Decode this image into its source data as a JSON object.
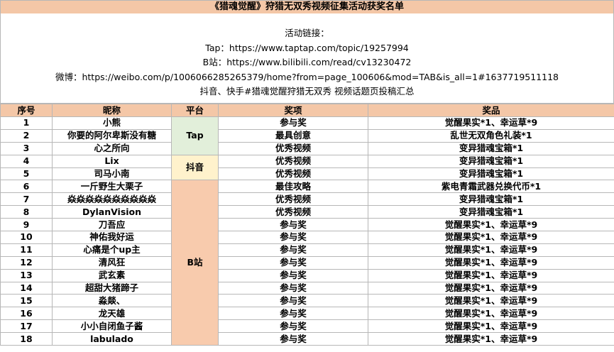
{
  "title": "《猎魂觉醒》狩猎无双秀视频征集活动获奖名单",
  "info": {
    "line1": "活动链接：",
    "line2": "Tap：https://www.taptap.com/topic/19257994",
    "line3": "B站：https://www.bilibili.com/read/cv13230472",
    "line4": "微博：https://weibo.com/p/1006066285265379/home?from=page_100606&mod=TAB&is_all=1#1637719511118",
    "line5": "抖音、快手#猎魂觉醒狩猎无双秀 视频话题页投稿汇总"
  },
  "table": {
    "headers": [
      "序号",
      "昵称",
      "平台",
      "奖项",
      "奖品"
    ],
    "platforms": [
      "Tap",
      "抖音",
      "B站"
    ],
    "rows": [
      {
        "no": "1",
        "name": "小熊",
        "award": "参与奖",
        "prize": "觉醒果实*1、幸运草*9"
      },
      {
        "no": "2",
        "name": "你要的阿尔卑斯没有糖",
        "award": "最具创意",
        "prize": "乱世无双角色礼装*1"
      },
      {
        "no": "3",
        "name": "心之所向",
        "award": "优秀视频",
        "prize": "变异猎魂宝箱*1"
      },
      {
        "no": "4",
        "name": "Lix",
        "award": "优秀视频",
        "prize": "变异猎魂宝箱*1"
      },
      {
        "no": "5",
        "name": "司马小南",
        "award": "优秀视频",
        "prize": "变异猎魂宝箱*1"
      },
      {
        "no": "6",
        "name": "一斤野生大栗子",
        "award": "最佳攻略",
        "prize": "紫电青霜武器兑换代币*1"
      },
      {
        "no": "7",
        "name": "焱焱焱焱焱焱焱焱焱焱",
        "award": "优秀视频",
        "prize": "变异猎魂宝箱*1"
      },
      {
        "no": "8",
        "name": "DylanVision",
        "award": "优秀视频",
        "prize": "变异猎魂宝箱*1"
      },
      {
        "no": "9",
        "name": "刀吾应",
        "award": "参与奖",
        "prize": "觉醒果实*1、幸运草*9"
      },
      {
        "no": "10",
        "name": "神佑我好运",
        "award": "参与奖",
        "prize": "觉醒果实*1、幸运草*9"
      },
      {
        "no": "11",
        "name": "心痛是个up主",
        "award": "参与奖",
        "prize": "觉醒果实*1、幸运草*9"
      },
      {
        "no": "12",
        "name": "清风狂",
        "award": "参与奖",
        "prize": "觉醒果实*1、幸运草*9"
      },
      {
        "no": "13",
        "name": "武玄素",
        "award": "参与奖",
        "prize": "觉醒果实*1、幸运草*9"
      },
      {
        "no": "14",
        "name": "超甜大猪蹄子",
        "award": "参与奖",
        "prize": "觉醒果实*1、幸运草*9"
      },
      {
        "no": "15",
        "name": "淼燚、",
        "award": "参与奖",
        "prize": "觉醒果实*1、幸运草*9"
      },
      {
        "no": "16",
        "name": "龙天雄",
        "award": "参与奖",
        "prize": "觉醒果实*1、幸运草*9"
      },
      {
        "no": "17",
        "name": "小小自闭鱼子酱",
        "award": "参与奖",
        "prize": "觉醒果实*1、幸运草*9"
      },
      {
        "no": "18",
        "name": "labulado",
        "award": "参与奖",
        "prize": "觉醒果实*1、幸运草*9"
      }
    ]
  },
  "colors": {
    "header_bg": "#f4c7a7",
    "tap_bg": "#e2efda",
    "douyin_bg": "#fff2cc",
    "bilibili_bg": "#f8cbad",
    "grid": "#b7b7b7"
  }
}
